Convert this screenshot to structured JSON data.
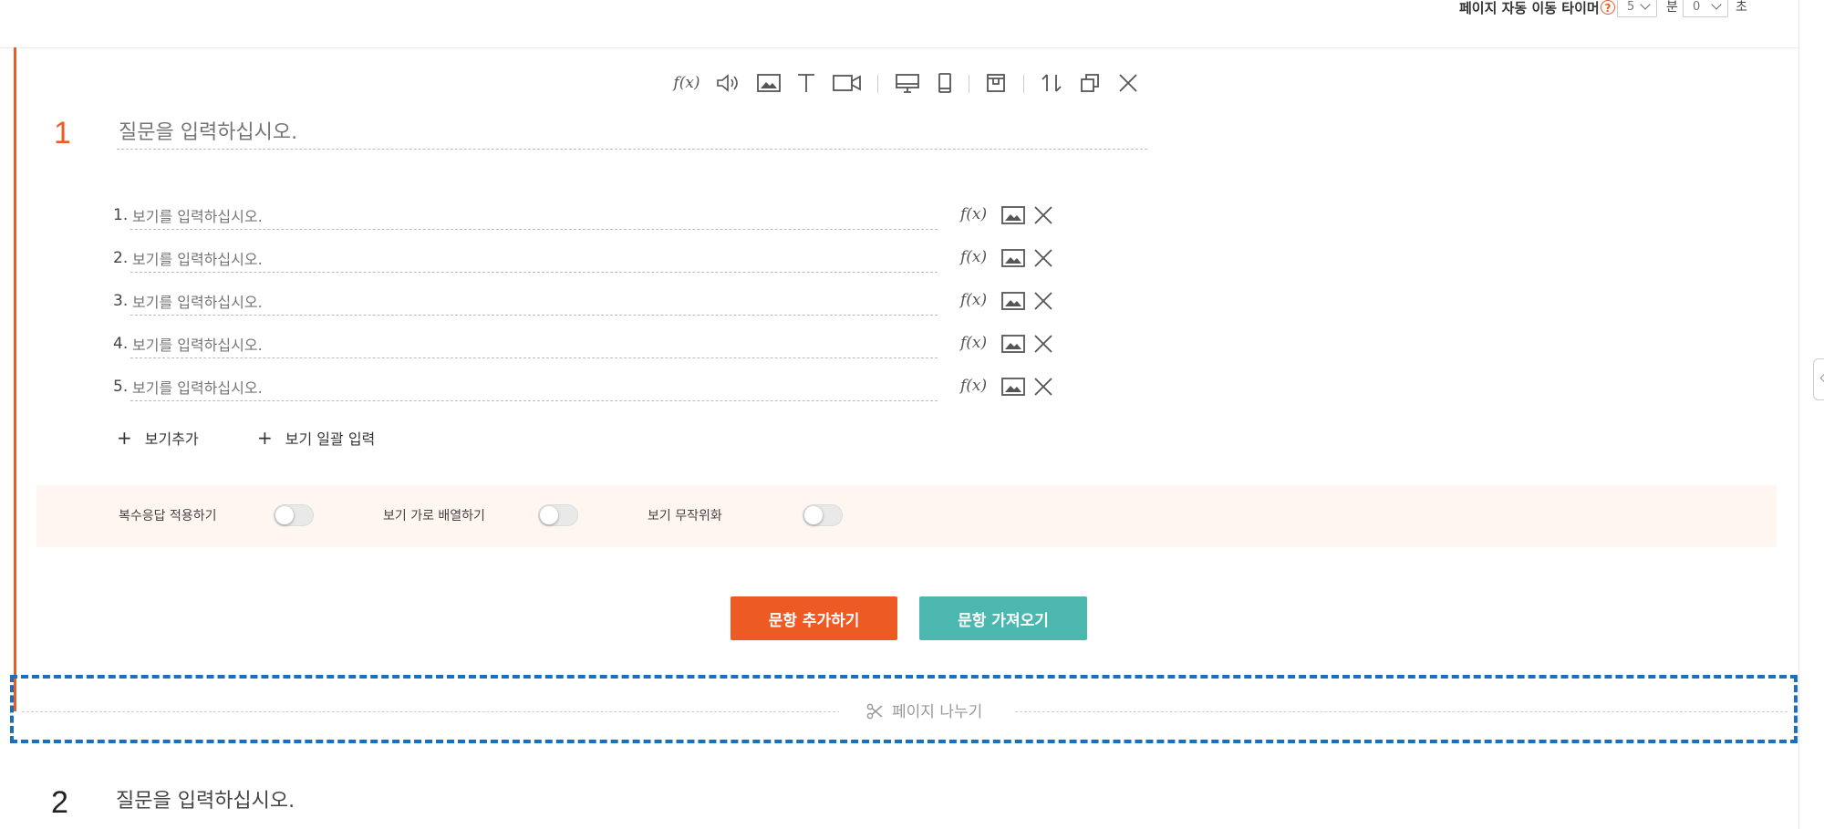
{
  "timer": {
    "label": "페이지 자동 이동 타이머",
    "help": "?",
    "minutes_value": "5",
    "minutes_unit": "분",
    "seconds_value": "0",
    "seconds_unit": "초"
  },
  "toolbar": {
    "fx": "f(x)"
  },
  "question1": {
    "number": "1",
    "placeholder": "질문을 입력하십시오.",
    "options": [
      {
        "num": "1.",
        "placeholder": "보기를 입력하십시오."
      },
      {
        "num": "2.",
        "placeholder": "보기를 입력하십시오."
      },
      {
        "num": "3.",
        "placeholder": "보기를 입력하십시오."
      },
      {
        "num": "4.",
        "placeholder": "보기를 입력하십시오."
      },
      {
        "num": "5.",
        "placeholder": "보기를 입력하십시오."
      }
    ],
    "option_fx": "f(x)",
    "add_option": "보기추가",
    "bulk_option": "보기 일괄 입력",
    "settings": {
      "multi_answer": "복수응답 적용하기",
      "horizontal": "보기 가로 배열하기",
      "randomize": "보기 무작위화"
    }
  },
  "buttons": {
    "add_question": "문항 추가하기",
    "import_question": "문항 가져오기"
  },
  "divider": {
    "label": "페이지 나누기"
  },
  "question2": {
    "number": "2",
    "title": "질문을 입력하십시오."
  }
}
